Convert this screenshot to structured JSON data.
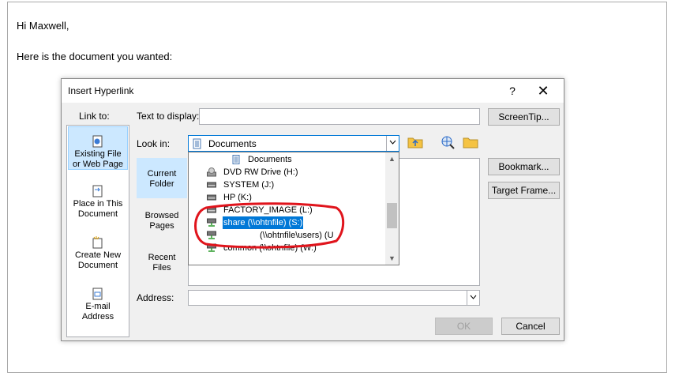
{
  "document": {
    "greeting": "Hi Maxwell,",
    "body_line": "Here is the document you wanted:"
  },
  "dialog": {
    "title": "Insert Hyperlink",
    "help_label": "?",
    "close_label": "✕",
    "link_to_label": "Link to:",
    "link_to_items": [
      {
        "label_1": "Existing File",
        "label_2": "or Web Page"
      },
      {
        "label_1": "Place in This",
        "label_2": "Document"
      },
      {
        "label_1": "Create New",
        "label_2": "Document"
      },
      {
        "label_1": "E-mail",
        "label_2": "Address"
      }
    ],
    "text_to_display_label": "Text to display:",
    "text_to_display_value": "",
    "screentip_label": "ScreenTip...",
    "look_in_label": "Look in:",
    "look_in_value": "Documents",
    "tabs": [
      {
        "label_1": "Current",
        "label_2": "Folder"
      },
      {
        "label_1": "Browsed",
        "label_2": "Pages"
      },
      {
        "label_1": "Recent",
        "label_2": "Files"
      }
    ],
    "dropdown_items": [
      {
        "text": "Documents",
        "icon": "documents-icon"
      },
      {
        "text": "DVD RW Drive (H:)",
        "icon": "dvd-drive-icon"
      },
      {
        "text": "SYSTEM (J:)",
        "icon": "drive-icon"
      },
      {
        "text": "HP (K:)",
        "icon": "drive-icon"
      },
      {
        "text": "FACTORY_IMAGE (L:)",
        "icon": "drive-icon"
      },
      {
        "text": "share (\\\\ohtnfile) (S:)",
        "icon": "network-drive-icon"
      },
      {
        "text": "(\\\\ohtnfile\\users) (U",
        "icon": "network-drive-icon"
      },
      {
        "text": "common (\\\\ohtnfile) (W:)",
        "icon": "network-drive-icon"
      }
    ],
    "bookmark_label": "Bookmark...",
    "target_frame_label": "Target Frame...",
    "address_label": "Address:",
    "address_value": "",
    "ok_label": "OK",
    "cancel_label": "Cancel"
  },
  "colors": {
    "highlight": "#0078d7",
    "selected_tab": "#cce8ff",
    "annotation_circle": "#e0141c"
  }
}
